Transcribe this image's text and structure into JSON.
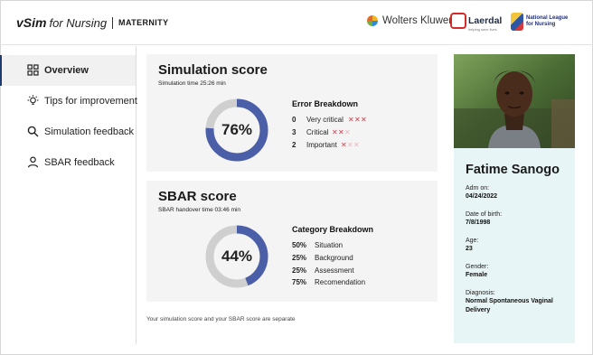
{
  "header": {
    "brand_v": "vSim",
    "brand_for": "for Nursing",
    "brand_section": "MATERNITY",
    "partner_wk": "Wolters Kluwer",
    "partner_laerdal": "Laerdal",
    "partner_laerdal_tag": "helping save lives",
    "partner_nln_line1": "National League",
    "partner_nln_line2": "for Nursing"
  },
  "sidebar": {
    "items": [
      {
        "label": "Overview",
        "icon": "grid-icon",
        "active": true
      },
      {
        "label": "Tips for improvement",
        "icon": "lightbulb-icon",
        "active": false
      },
      {
        "label": "Simulation feedback",
        "icon": "search-icon",
        "active": false
      },
      {
        "label": "SBAR feedback",
        "icon": "user-icon",
        "active": false
      }
    ]
  },
  "simulation": {
    "title": "Simulation score",
    "subtitle": "Simulation time 25:26 min",
    "score_text": "76%",
    "score_fraction": 0.76,
    "breakdown_title": "Error Breakdown",
    "rows": [
      {
        "count": "0",
        "label": "Very critical",
        "active_marks": 3,
        "total_marks": 3
      },
      {
        "count": "3",
        "label": "Critical",
        "active_marks": 2,
        "total_marks": 3
      },
      {
        "count": "2",
        "label": "Important",
        "active_marks": 1,
        "total_marks": 3
      }
    ]
  },
  "sbar": {
    "title": "SBAR score",
    "subtitle": "SBAR handover time 03:46 min",
    "score_text": "44%",
    "score_fraction": 0.44,
    "breakdown_title": "Category Breakdown",
    "rows": [
      {
        "pct": "50%",
        "label": "Situation"
      },
      {
        "pct": "25%",
        "label": "Background"
      },
      {
        "pct": "25%",
        "label": "Assessment"
      },
      {
        "pct": "75%",
        "label": "Recomendation"
      }
    ]
  },
  "footnote": "Your simulation score and your SBAR score are separate",
  "patient": {
    "name": "Fatime Sanogo",
    "fields": [
      {
        "label": "Adm on:",
        "value": "04/24/2022"
      },
      {
        "label": "Date of birth:",
        "value": "7/8/1998"
      },
      {
        "label": "Age:",
        "value": "23"
      },
      {
        "label": "Gender:",
        "value": "Female"
      },
      {
        "label": "Diagnosis:",
        "value": "Normal Spontaneous Vaginal Delivery"
      }
    ]
  },
  "colors": {
    "accent": "#4a5fa8",
    "ring_track": "#cfcfcf",
    "mark_red": "#d9394a",
    "patient_panel": "#e8f5f6",
    "nav_active_border": "#1d3b6e"
  }
}
